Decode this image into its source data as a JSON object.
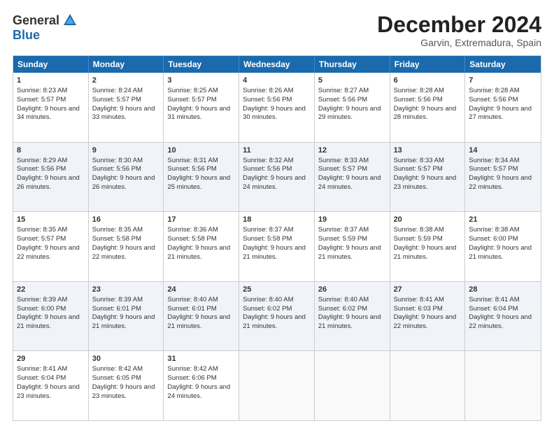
{
  "logo": {
    "general": "General",
    "blue": "Blue"
  },
  "title": "December 2024",
  "subtitle": "Garvin, Extremadura, Spain",
  "days": [
    "Sunday",
    "Monday",
    "Tuesday",
    "Wednesday",
    "Thursday",
    "Friday",
    "Saturday"
  ],
  "weeks": [
    [
      {
        "day": "1",
        "sunrise": "Sunrise: 8:23 AM",
        "sunset": "Sunset: 5:57 PM",
        "daylight": "Daylight: 9 hours and 34 minutes."
      },
      {
        "day": "2",
        "sunrise": "Sunrise: 8:24 AM",
        "sunset": "Sunset: 5:57 PM",
        "daylight": "Daylight: 9 hours and 33 minutes."
      },
      {
        "day": "3",
        "sunrise": "Sunrise: 8:25 AM",
        "sunset": "Sunset: 5:57 PM",
        "daylight": "Daylight: 9 hours and 31 minutes."
      },
      {
        "day": "4",
        "sunrise": "Sunrise: 8:26 AM",
        "sunset": "Sunset: 5:56 PM",
        "daylight": "Daylight: 9 hours and 30 minutes."
      },
      {
        "day": "5",
        "sunrise": "Sunrise: 8:27 AM",
        "sunset": "Sunset: 5:56 PM",
        "daylight": "Daylight: 9 hours and 29 minutes."
      },
      {
        "day": "6",
        "sunrise": "Sunrise: 8:28 AM",
        "sunset": "Sunset: 5:56 PM",
        "daylight": "Daylight: 9 hours and 28 minutes."
      },
      {
        "day": "7",
        "sunrise": "Sunrise: 8:28 AM",
        "sunset": "Sunset: 5:56 PM",
        "daylight": "Daylight: 9 hours and 27 minutes."
      }
    ],
    [
      {
        "day": "8",
        "sunrise": "Sunrise: 8:29 AM",
        "sunset": "Sunset: 5:56 PM",
        "daylight": "Daylight: 9 hours and 26 minutes."
      },
      {
        "day": "9",
        "sunrise": "Sunrise: 8:30 AM",
        "sunset": "Sunset: 5:56 PM",
        "daylight": "Daylight: 9 hours and 26 minutes."
      },
      {
        "day": "10",
        "sunrise": "Sunrise: 8:31 AM",
        "sunset": "Sunset: 5:56 PM",
        "daylight": "Daylight: 9 hours and 25 minutes."
      },
      {
        "day": "11",
        "sunrise": "Sunrise: 8:32 AM",
        "sunset": "Sunset: 5:56 PM",
        "daylight": "Daylight: 9 hours and 24 minutes."
      },
      {
        "day": "12",
        "sunrise": "Sunrise: 8:33 AM",
        "sunset": "Sunset: 5:57 PM",
        "daylight": "Daylight: 9 hours and 24 minutes."
      },
      {
        "day": "13",
        "sunrise": "Sunrise: 8:33 AM",
        "sunset": "Sunset: 5:57 PM",
        "daylight": "Daylight: 9 hours and 23 minutes."
      },
      {
        "day": "14",
        "sunrise": "Sunrise: 8:34 AM",
        "sunset": "Sunset: 5:57 PM",
        "daylight": "Daylight: 9 hours and 22 minutes."
      }
    ],
    [
      {
        "day": "15",
        "sunrise": "Sunrise: 8:35 AM",
        "sunset": "Sunset: 5:57 PM",
        "daylight": "Daylight: 9 hours and 22 minutes."
      },
      {
        "day": "16",
        "sunrise": "Sunrise: 8:35 AM",
        "sunset": "Sunset: 5:58 PM",
        "daylight": "Daylight: 9 hours and 22 minutes."
      },
      {
        "day": "17",
        "sunrise": "Sunrise: 8:36 AM",
        "sunset": "Sunset: 5:58 PM",
        "daylight": "Daylight: 9 hours and 21 minutes."
      },
      {
        "day": "18",
        "sunrise": "Sunrise: 8:37 AM",
        "sunset": "Sunset: 5:58 PM",
        "daylight": "Daylight: 9 hours and 21 minutes."
      },
      {
        "day": "19",
        "sunrise": "Sunrise: 8:37 AM",
        "sunset": "Sunset: 5:59 PM",
        "daylight": "Daylight: 9 hours and 21 minutes."
      },
      {
        "day": "20",
        "sunrise": "Sunrise: 8:38 AM",
        "sunset": "Sunset: 5:59 PM",
        "daylight": "Daylight: 9 hours and 21 minutes."
      },
      {
        "day": "21",
        "sunrise": "Sunrise: 8:38 AM",
        "sunset": "Sunset: 6:00 PM",
        "daylight": "Daylight: 9 hours and 21 minutes."
      }
    ],
    [
      {
        "day": "22",
        "sunrise": "Sunrise: 8:39 AM",
        "sunset": "Sunset: 6:00 PM",
        "daylight": "Daylight: 9 hours and 21 minutes."
      },
      {
        "day": "23",
        "sunrise": "Sunrise: 8:39 AM",
        "sunset": "Sunset: 6:01 PM",
        "daylight": "Daylight: 9 hours and 21 minutes."
      },
      {
        "day": "24",
        "sunrise": "Sunrise: 8:40 AM",
        "sunset": "Sunset: 6:01 PM",
        "daylight": "Daylight: 9 hours and 21 minutes."
      },
      {
        "day": "25",
        "sunrise": "Sunrise: 8:40 AM",
        "sunset": "Sunset: 6:02 PM",
        "daylight": "Daylight: 9 hours and 21 minutes."
      },
      {
        "day": "26",
        "sunrise": "Sunrise: 8:40 AM",
        "sunset": "Sunset: 6:02 PM",
        "daylight": "Daylight: 9 hours and 21 minutes."
      },
      {
        "day": "27",
        "sunrise": "Sunrise: 8:41 AM",
        "sunset": "Sunset: 6:03 PM",
        "daylight": "Daylight: 9 hours and 22 minutes."
      },
      {
        "day": "28",
        "sunrise": "Sunrise: 8:41 AM",
        "sunset": "Sunset: 6:04 PM",
        "daylight": "Daylight: 9 hours and 22 minutes."
      }
    ],
    [
      {
        "day": "29",
        "sunrise": "Sunrise: 8:41 AM",
        "sunset": "Sunset: 6:04 PM",
        "daylight": "Daylight: 9 hours and 23 minutes."
      },
      {
        "day": "30",
        "sunrise": "Sunrise: 8:42 AM",
        "sunset": "Sunset: 6:05 PM",
        "daylight": "Daylight: 9 hours and 23 minutes."
      },
      {
        "day": "31",
        "sunrise": "Sunrise: 8:42 AM",
        "sunset": "Sunset: 6:06 PM",
        "daylight": "Daylight: 9 hours and 24 minutes."
      },
      null,
      null,
      null,
      null
    ]
  ]
}
